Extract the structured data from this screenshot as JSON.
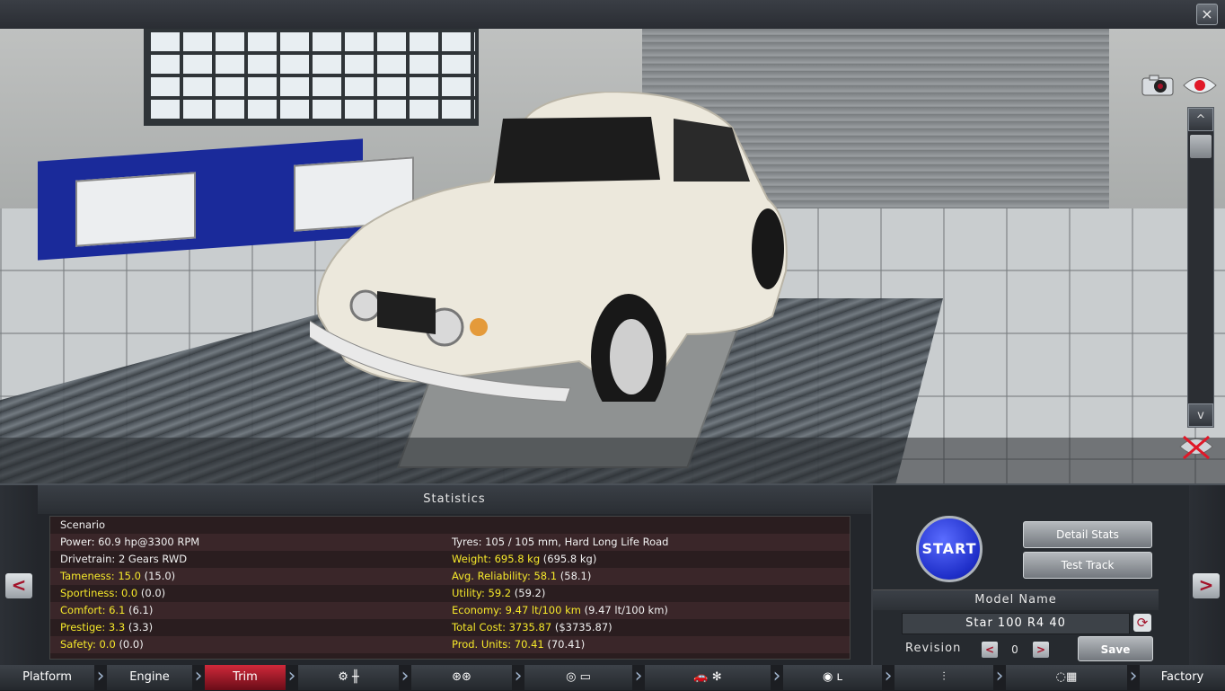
{
  "window": {
    "close_label": "×"
  },
  "viewer": {
    "camera_icon": "camera-icon",
    "view_icon": "eye-icon",
    "scroll_up": "^",
    "scroll_down": "v",
    "hide_icon": "hide-ui-icon"
  },
  "statistics": {
    "title": "Statistics",
    "left": [
      {
        "label": "Scenario",
        "value": "",
        "highlight": false
      },
      {
        "label": "Power: 60.9 hp@3300 RPM",
        "value": "",
        "highlight": false
      },
      {
        "label": "Drivetrain: 2 Gears RWD",
        "value": "",
        "highlight": false
      },
      {
        "label": "Tameness: 15.0",
        "value": "(15.0)",
        "highlight": true
      },
      {
        "label": "Sportiness: 0.0",
        "value": "(0.0)",
        "highlight": true
      },
      {
        "label": "Comfort: 6.1",
        "value": "(6.1)",
        "highlight": true
      },
      {
        "label": "Prestige: 3.3",
        "value": "(3.3)",
        "highlight": true
      },
      {
        "label": "Safety: 0.0",
        "value": "(0.0)",
        "highlight": true
      }
    ],
    "right": [
      {
        "label": "",
        "value": ""
      },
      {
        "label": "Tyres: 105 / 105 mm, Hard Long Life Road",
        "value": "",
        "highlight": false
      },
      {
        "label": "Weight: 695.8 kg",
        "value": "(695.8 kg)",
        "highlight": true
      },
      {
        "label": "Avg. Reliability: 58.1",
        "value": "(58.1)",
        "highlight": true
      },
      {
        "label": "Utility: 59.2",
        "value": "(59.2)",
        "highlight": true
      },
      {
        "label": "Economy: 9.47 lt/100 km",
        "value": "(9.47 lt/100 km)",
        "highlight": true
      },
      {
        "label": "Total Cost: 3735.87",
        "value": "($3735.87)",
        "highlight": true
      },
      {
        "label": "Prod. Units: 70.41",
        "value": "(70.41)",
        "highlight": true
      }
    ]
  },
  "actions": {
    "start": "START",
    "detail_stats": "Detail Stats",
    "test_track": "Test Track",
    "model_name_title": "Model Name",
    "model_name_value": "Star 100 R4 40",
    "revision_label": "Revision",
    "revision_value": "0",
    "rev_prev": "<",
    "rev_next": ">",
    "save": "Save"
  },
  "side_nav": {
    "prev": "<",
    "next": ">"
  },
  "bottom_tabs": {
    "platform": "Platform",
    "engine": "Engine",
    "trim": "Trim",
    "factory": "Factory",
    "icons": [
      "gear-icon",
      "gearbox-icon",
      "wheels-icon",
      "brake-icon",
      "body-icon",
      "car-icon",
      "fan-icon",
      "steering-icon",
      "seat-icon",
      "suspension-icon",
      "finish-flag-icon"
    ]
  },
  "colors": {
    "accent_red": "#a3132a",
    "stat_yellow": "#f6e92a",
    "start_blue": "#1e2ec8"
  }
}
